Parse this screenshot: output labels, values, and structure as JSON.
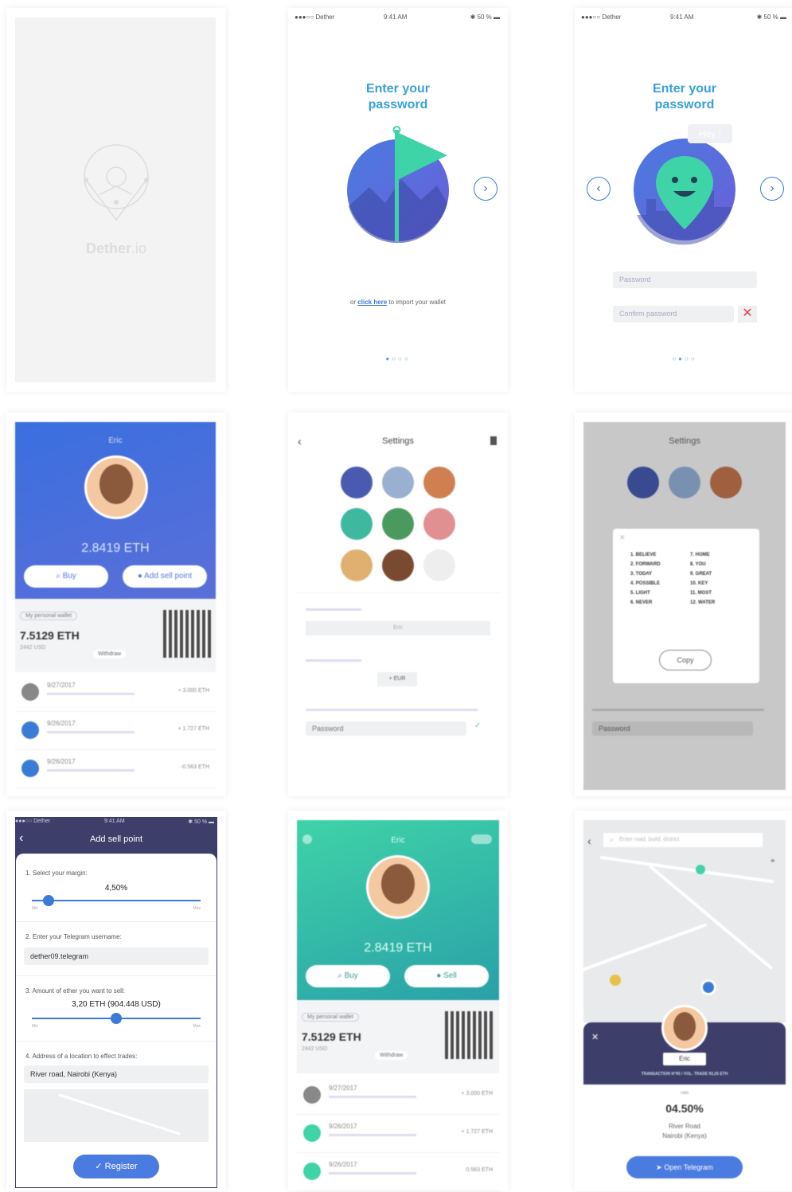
{
  "splash": {
    "brand_bold": "Dether",
    "brand_light": ".io"
  },
  "status": {
    "carrier": "●●●○○ Dether ",
    "time": "9:41 AM",
    "battery": "✱ 50 % ▬"
  },
  "onboard1": {
    "title_line1": "Enter your",
    "title_line2": "password",
    "import_prefix": "or ",
    "import_link": "click here",
    "import_suffix": " to import your wallet",
    "dots": "●○○○"
  },
  "onboard2": {
    "title_line1": "Enter your",
    "title_line2": "password",
    "bubble": "Hey !",
    "password_placeholder": "Password",
    "confirm_placeholder": "Confirm password",
    "dots": "○●○○"
  },
  "wallet": {
    "user": "Eric",
    "balance": "2.8419 ETH",
    "buy_label": "Buy",
    "add_sell_label": "Add sell point",
    "wallet_badge": "My personal wallet",
    "wallet_eth": "7.5129 ETH",
    "wallet_usd": "2442 USD",
    "withdraw": "Withdraw",
    "tx": [
      {
        "date": "9/27/2017",
        "amount": "+ 3.000 ETH"
      },
      {
        "date": "9/26/2017",
        "amount": "+ 1.727 ETH"
      },
      {
        "date": "9/26/2017",
        "amount": "-0.563 ETH"
      }
    ]
  },
  "settings": {
    "title": "Settings",
    "password_placeholder": "Password",
    "currency": "+ EUR",
    "username": "Eric"
  },
  "settings_modal": {
    "title": "Settings",
    "words": [
      "1. BELIEVE",
      "7. HOME",
      "2. FORWARD",
      "8. YOU",
      "3. TODAY",
      "9. GREAT",
      "4. POSSIBLE",
      "10. KEY",
      "5. LIGHT",
      "11. MOST",
      "6. NEVER",
      "12. WATER"
    ],
    "copy_label": "Copy",
    "password_placeholder": "Password"
  },
  "sellpoint": {
    "title": "Add sell point",
    "step1": "1. Select your margin:",
    "margin": "4,50%",
    "min": "Min",
    "max": "Max",
    "step2": "2. Enter your Telegram username:",
    "telegram": "dether09.telegram",
    "step3": "3. Amount of ether you want to sell:",
    "amount": "3,20 ETH (904.448 USD)",
    "step4": "4. Address of a location to effect trades:",
    "address": "River road, Nairobi (Kenya)",
    "register": "Register",
    "margin_level": 0.1,
    "amount_level": 0.5
  },
  "wallet2": {
    "user": "Eric",
    "balance": "2.8419 ETH",
    "buy_label": "Buy",
    "sell_label": "Sell",
    "wallet_badge": "My personal wallet",
    "wallet_eth": "7.5129 ETH",
    "wallet_usd": "2442 USD",
    "withdraw": "Withdraw",
    "tx": [
      {
        "date": "9/27/2017",
        "amount": "+ 3.000 ETH"
      },
      {
        "date": "9/26/2017",
        "amount": "+ 1.727 ETH"
      },
      {
        "date": "9/26/2017",
        "amount": "0.563 ETH"
      }
    ]
  },
  "map": {
    "search_placeholder": "Enter road, build, district",
    "user": "Eric",
    "stats": "TRANSACTION N°95 / VOL. TRADE 93,26 ETH",
    "rate_label": "rate",
    "rate": "04.50%",
    "address1": "River Road",
    "address2": "Nairobi (Kenya)",
    "open_telegram": "Open Telegram"
  }
}
